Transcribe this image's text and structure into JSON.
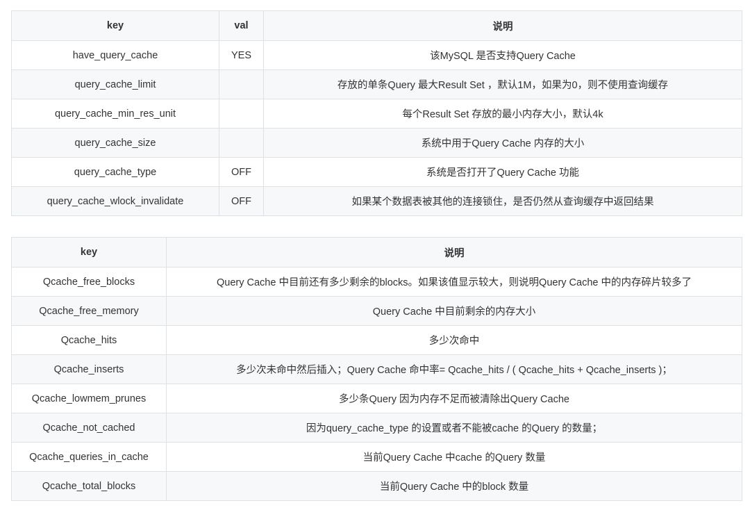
{
  "table1": {
    "headers": [
      "key",
      "val",
      "说明"
    ],
    "rows": [
      [
        "have_query_cache",
        "YES",
        "该MySQL 是否支持Query Cache"
      ],
      [
        "query_cache_limit",
        "",
        "存放的单条Query 最大Result Set ，默认1M，如果为0，则不使用查询缓存"
      ],
      [
        "query_cache_min_res_unit",
        "",
        "每个Result Set 存放的最小内存大小，默认4k"
      ],
      [
        "query_cache_size",
        "",
        "系统中用于Query Cache 内存的大小"
      ],
      [
        "query_cache_type",
        "OFF",
        "系统是否打开了Query Cache 功能"
      ],
      [
        "query_cache_wlock_invalidate",
        "OFF",
        "如果某个数据表被其他的连接锁住，是否仍然从查询缓存中返回结果"
      ]
    ]
  },
  "table2": {
    "headers": [
      "key",
      "说明"
    ],
    "rows": [
      [
        "Qcache_free_blocks",
        "Query Cache 中目前还有多少剩余的blocks。如果该值显示较大，则说明Query Cache 中的内存碎片较多了"
      ],
      [
        "Qcache_free_memory",
        "Query Cache 中目前剩余的内存大小"
      ],
      [
        "Qcache_hits",
        "多少次命中"
      ],
      [
        "Qcache_inserts",
        "多少次未命中然后插入；Query Cache 命中率= Qcache_hits / ( Qcache_hits + Qcache_inserts )；"
      ],
      [
        "Qcache_lowmem_prunes",
        "多少条Query 因为内存不足而被清除出Query Cache"
      ],
      [
        "Qcache_not_cached",
        "因为query_cache_type 的设置或者不能被cache 的Query 的数量；"
      ],
      [
        "Qcache_queries_in_cache",
        "当前Query Cache 中cache 的Query 数量"
      ],
      [
        "Qcache_total_blocks",
        "当前Query Cache 中的block 数量"
      ]
    ]
  }
}
